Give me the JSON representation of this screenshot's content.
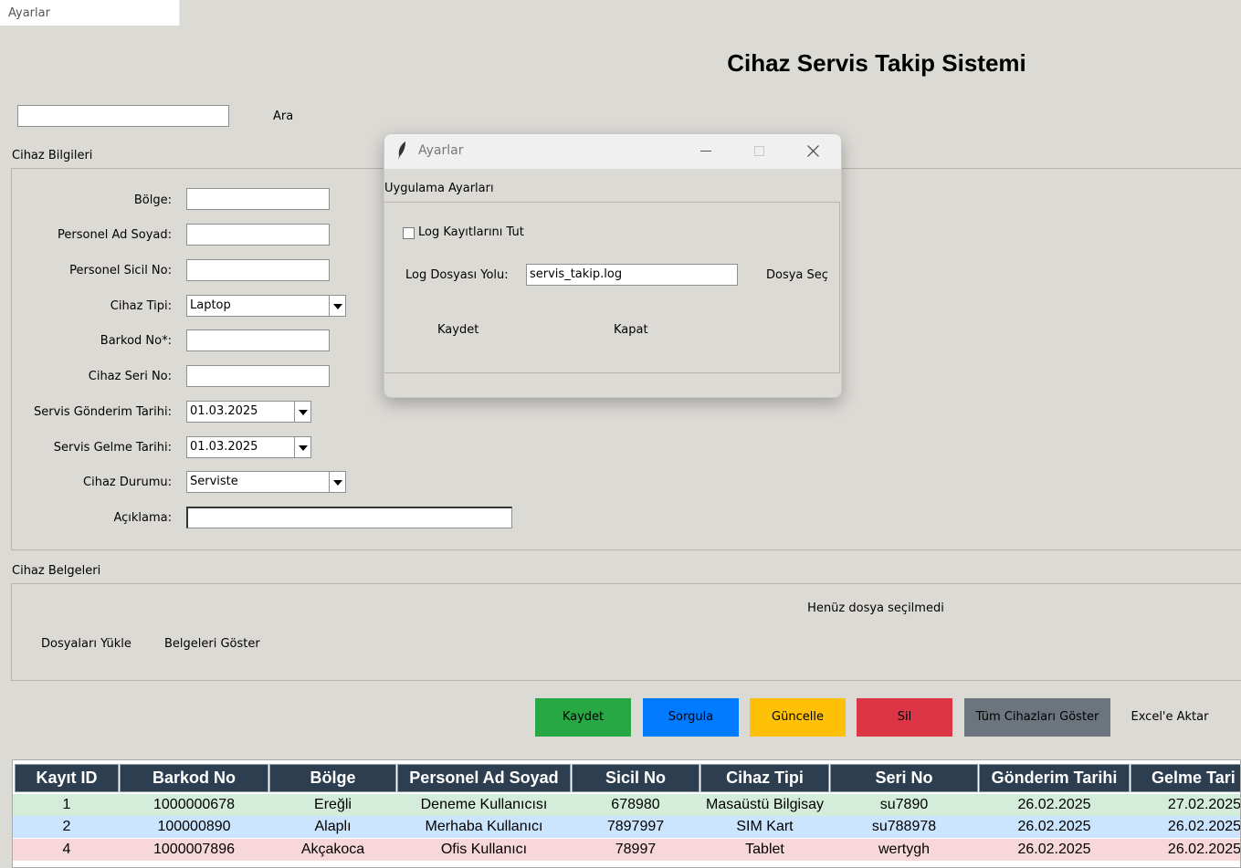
{
  "window": {
    "title": "Ayarlar"
  },
  "app": {
    "title": "Cihaz Servis Takip Sistemi"
  },
  "search": {
    "value": "",
    "button": "Ara"
  },
  "device_info": {
    "section_label": "Cihaz Bilgileri",
    "fields": {
      "bolge": {
        "label": "Bölge:",
        "value": ""
      },
      "personel_ad": {
        "label": "Personel Ad Soyad:",
        "value": ""
      },
      "personel_sicil": {
        "label": "Personel Sicil No:",
        "value": ""
      },
      "cihaz_tipi": {
        "label": "Cihaz Tipi:",
        "value": "Laptop"
      },
      "barkod": {
        "label": "Barkod No*:",
        "value": ""
      },
      "seri": {
        "label": "Cihaz Seri No:",
        "value": ""
      },
      "gonderim": {
        "label": "Servis Gönderim Tarihi:",
        "value": "01.03.2025"
      },
      "gelme": {
        "label": "Servis Gelme Tarihi:",
        "value": "01.03.2025"
      },
      "durum": {
        "label": "Cihaz Durumu:",
        "value": "Serviste"
      },
      "aciklama": {
        "label": "Açıklama:",
        "value": ""
      }
    }
  },
  "documents": {
    "section_label": "Cihaz Belgeleri",
    "status": "Henüz dosya seçilmedi",
    "upload_button": "Dosyaları Yükle",
    "show_button": "Belgeleri Göster"
  },
  "actions": {
    "kaydet": "Kaydet",
    "sorgula": "Sorgula",
    "guncelle": "Güncelle",
    "sil": "Sil",
    "tum": "Tüm Cihazları Göster",
    "excel": "Excel'e Aktar",
    "colors": {
      "kaydet": "#28a745",
      "sorgula": "#007bff",
      "guncelle": "#ffc107",
      "sil": "#dc3545",
      "tum": "#6c757d"
    }
  },
  "table": {
    "columns": [
      "Kayıt ID",
      "Barkod No",
      "Bölge",
      "Personel Ad Soyad",
      "Sicil No",
      "Cihaz Tipi",
      "Seri No",
      "Gönderim Tarihi",
      "Gelme Tari"
    ],
    "rows": [
      {
        "cells": [
          "1",
          "1000000678",
          "Ereğli",
          "Deneme Kullanıcısı",
          "678980",
          "Masaüstü Bilgisay",
          "su7890",
          "26.02.2025",
          "27.02.2025"
        ],
        "color": "#d4edda"
      },
      {
        "cells": [
          "2",
          "100000890",
          "Alaplı",
          "Merhaba Kullanıcı",
          "7897997",
          "SIM Kart",
          "su788978",
          "26.02.2025",
          "26.02.2025"
        ],
        "color": "#cce5ff"
      },
      {
        "cells": [
          "4",
          "1000007896",
          "Akçakoca",
          "Ofis Kullanıcı",
          "78997",
          "Tablet",
          "wertygh",
          "26.02.2025",
          "26.02.2025"
        ],
        "color": "#f8d7da"
      }
    ]
  },
  "dialog": {
    "title": "Ayarlar",
    "section_label": "Uygulama Ayarları",
    "log_checkbox": {
      "label": "Log Kayıtlarını Tut",
      "checked": false
    },
    "log_path": {
      "label": "Log Dosyası Yolu:",
      "value": "servis_takip.log"
    },
    "choose_file": "Dosya Seç",
    "save": "Kaydet",
    "close": "Kapat"
  }
}
